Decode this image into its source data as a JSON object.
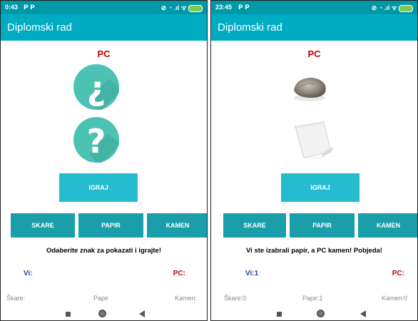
{
  "screens": [
    {
      "status_time": "0:43",
      "status_apps": "𝗣 𝗣",
      "status_icons": "⊘ ◔ .ıl ᯤ",
      "app_title": "Diplomski rad",
      "pc_label": "PC",
      "play_button": "IGRAJ",
      "choices": [
        "SKARE",
        "PAPIR",
        "KAMEN"
      ],
      "message": "Odaberite znak za pokazati i igrajte!",
      "you_label": "Vi:",
      "pc_score_label": "PC:",
      "stats": [
        "Škare:",
        "Papir",
        "Kamen:"
      ],
      "images": [
        "question-mark-spanish-icon",
        "question-mark-icon"
      ]
    },
    {
      "status_time": "23:45",
      "status_apps": "𝗣 𝗣",
      "status_icons": "⊘ ◔ .ıl ᯤ",
      "app_title": "Diplomski rad",
      "pc_label": "PC",
      "play_button": "IGRAJ",
      "choices": [
        "SKARE",
        "PAPIR",
        "KAMEN"
      ],
      "message": "Vi ste izabrali papir, a PC kamen! Pobjeda!",
      "you_label": "Vi:1",
      "pc_score_label": "PC:",
      "stats": [
        "Škare:0",
        "Papir:1",
        "Kamen:0"
      ],
      "images": [
        "rock-image",
        "paper-image"
      ]
    }
  ],
  "colors": {
    "statusbar": "#0097a7",
    "appbar": "#00acc1",
    "play_button": "#26bcd0",
    "choice_buttons": "#199eaa",
    "pc_red": "#c00000",
    "you_blue": "#1f3fb0",
    "icon_teal": "#4cc2b2"
  }
}
